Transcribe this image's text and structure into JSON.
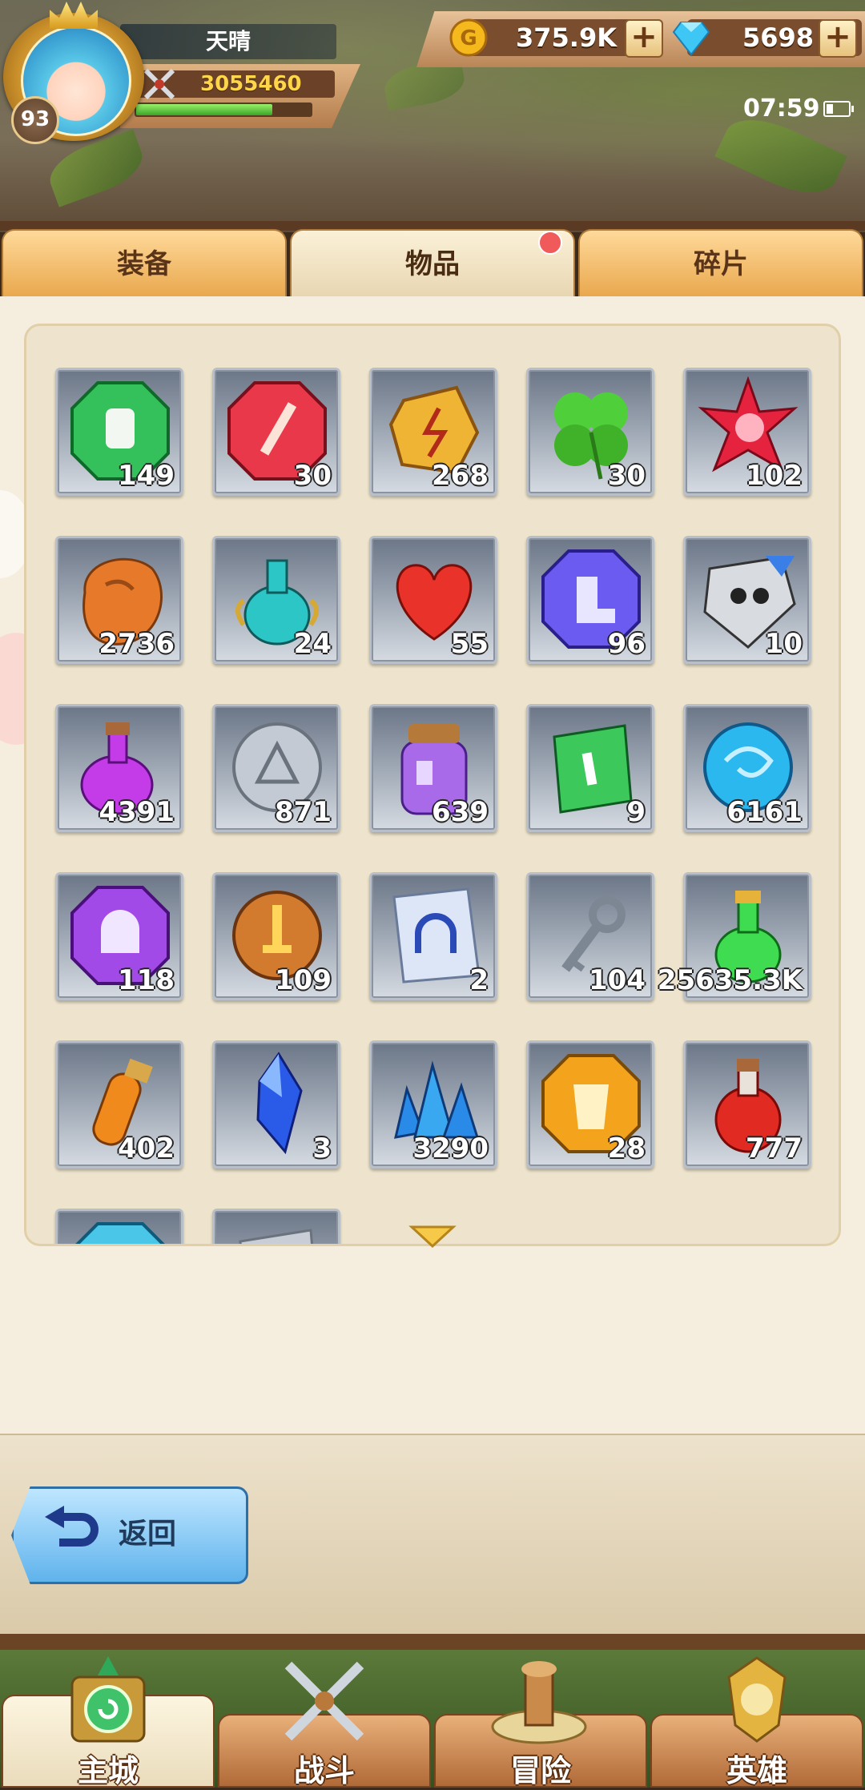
{
  "player": {
    "name": "天晴",
    "level": "93",
    "power": "3055460",
    "exp_fraction": 0.78
  },
  "currency": {
    "gold": "375.9K",
    "gems": "5698",
    "plus": "+"
  },
  "status": {
    "time": "07:59"
  },
  "tabs": [
    {
      "label": "装备"
    },
    {
      "label": "物品"
    },
    {
      "label": "碎片"
    }
  ],
  "items": [
    {
      "icon": "green-gauntlet-gem-icon",
      "count": "149"
    },
    {
      "icon": "red-sword-gem-icon",
      "count": "30"
    },
    {
      "icon": "gold-lightning-stone-icon",
      "count": "268"
    },
    {
      "icon": "four-leaf-clover-icon",
      "count": "30"
    },
    {
      "icon": "red-spiky-crystal-icon",
      "count": "102"
    },
    {
      "icon": "orange-ore-icon",
      "count": "2736"
    },
    {
      "icon": "teal-potion-vase-icon",
      "count": "24"
    },
    {
      "icon": "red-heart-icon",
      "count": "55"
    },
    {
      "icon": "purple-boots-gem-icon",
      "count": "96"
    },
    {
      "icon": "skull-shield-icon",
      "count": "10"
    },
    {
      "icon": "purple-potion-icon",
      "count": "4391"
    },
    {
      "icon": "silver-coin-icon",
      "count": "871"
    },
    {
      "icon": "purple-crystal-jar-icon",
      "count": "639"
    },
    {
      "icon": "green-scroll-icon",
      "count": "9"
    },
    {
      "icon": "blue-orb-icon",
      "count": "6161"
    },
    {
      "icon": "purple-helmet-gem-icon",
      "count": "118"
    },
    {
      "icon": "bronze-sword-coin-icon",
      "count": "109"
    },
    {
      "icon": "helmet-blueprint-icon",
      "count": "2"
    },
    {
      "icon": "silver-key-icon",
      "count": "104"
    },
    {
      "icon": "green-potion-icon",
      "count": "25635.3K"
    },
    {
      "icon": "orange-potion-vial-icon",
      "count": "402"
    },
    {
      "icon": "blue-crystal-shard-icon",
      "count": "3"
    },
    {
      "icon": "blue-crystal-cluster-icon",
      "count": "3290"
    },
    {
      "icon": "gold-armor-gem-icon",
      "count": "28"
    },
    {
      "icon": "red-potion-icon",
      "count": "777"
    },
    {
      "icon": "cyan-gem-partial-icon",
      "count": ""
    },
    {
      "icon": "scroll-partial-icon",
      "count": ""
    }
  ],
  "back_button": {
    "label": "返回"
  },
  "nav": [
    {
      "label": "主城"
    },
    {
      "label": "战斗"
    },
    {
      "label": "冒险"
    },
    {
      "label": "英雄"
    }
  ],
  "colors": {
    "tab_active": "#fbf1d8",
    "tab_inactive": "#e9a84e",
    "power_text": "#ffd64a",
    "notification_dot": "#f05a5a"
  }
}
